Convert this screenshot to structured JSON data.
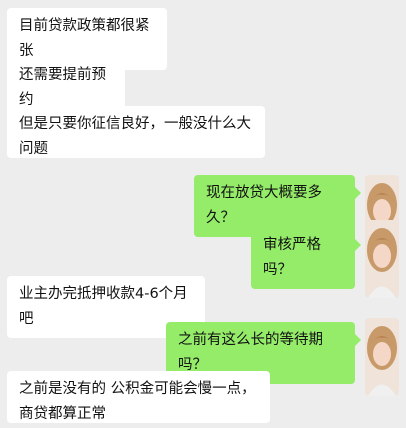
{
  "messages": [
    {
      "side": "in",
      "text": "目前贷款政策都很紧张"
    },
    {
      "side": "in",
      "text": "还需要提前预约"
    },
    {
      "side": "in",
      "text": "但是只要你征信良好，一般没什么大问题"
    },
    {
      "side": "out",
      "text": "现在放贷大概要多久？"
    },
    {
      "side": "out",
      "text": "审核严格吗？"
    },
    {
      "side": "in",
      "text": "业主办完抵押收款4-6个月吧"
    },
    {
      "side": "out",
      "text": "之前有这么长的等待期吗？"
    },
    {
      "side": "in",
      "text": "之前是没有的 公积金可能会慢一点，商贷都算正常"
    }
  ],
  "colors": {
    "background": "#ededed",
    "incoming_bubble": "#ffffff",
    "outgoing_bubble": "#95ec69"
  },
  "avatar_icon": "user-avatar-photo"
}
